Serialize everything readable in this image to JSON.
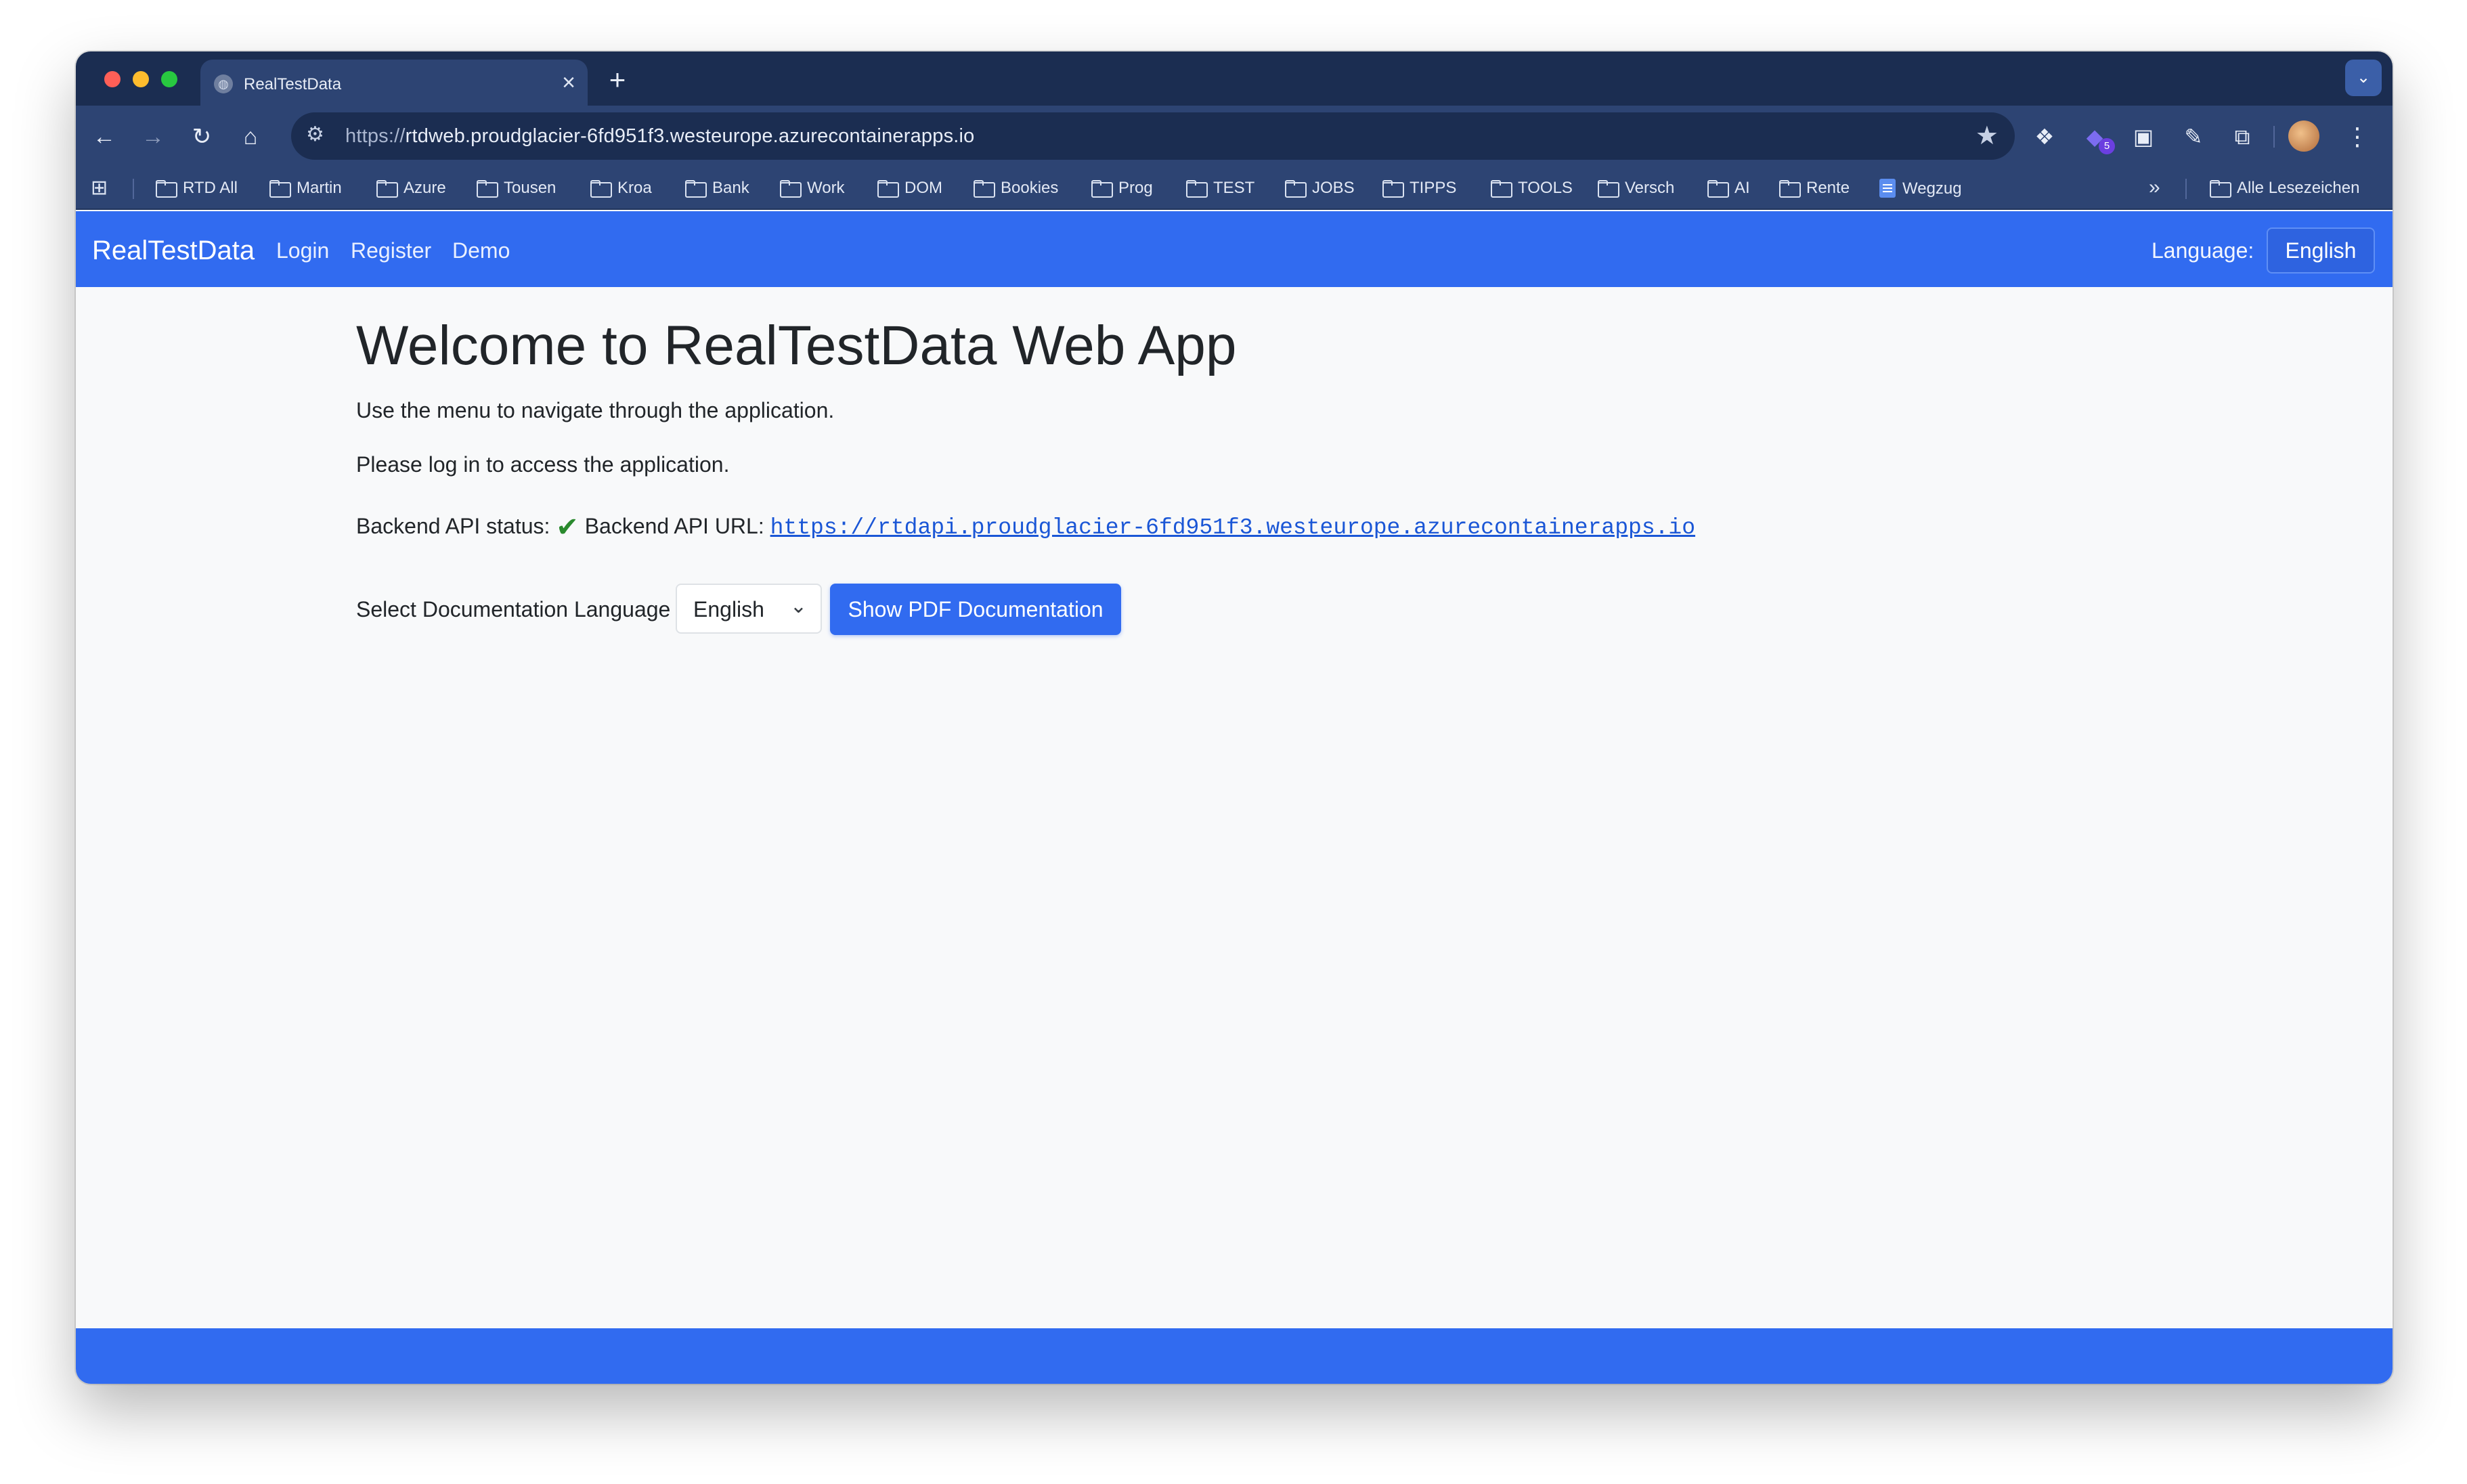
{
  "browser": {
    "tab_title": "RealTestData",
    "new_tab_symbol": "+",
    "url_scheme": "https://",
    "url_rest": "rtdweb.proudglacier-6fd951f3.westeurope.azurecontainerapps.io",
    "extension_badge": "5",
    "bookmarks": [
      {
        "label": "RTD All",
        "icon": "folder-icon"
      },
      {
        "label": "Martin",
        "icon": "folder-icon"
      },
      {
        "label": "Azure",
        "icon": "folder-icon"
      },
      {
        "label": "Tousen",
        "icon": "folder-icon"
      },
      {
        "label": "Kroa",
        "icon": "folder-icon"
      },
      {
        "label": "Bank",
        "icon": "folder-icon"
      },
      {
        "label": "Work",
        "icon": "folder-icon"
      },
      {
        "label": "DOM",
        "icon": "folder-icon"
      },
      {
        "label": "Bookies",
        "icon": "folder-icon"
      },
      {
        "label": "Prog",
        "icon": "folder-icon"
      },
      {
        "label": "TEST",
        "icon": "folder-icon"
      },
      {
        "label": "JOBS",
        "icon": "folder-icon"
      },
      {
        "label": "TIPPS",
        "icon": "folder-icon"
      },
      {
        "label": "TOOLS",
        "icon": "folder-icon"
      },
      {
        "label": "Versch",
        "icon": "folder-icon"
      },
      {
        "label": "AI",
        "icon": "folder-icon"
      },
      {
        "label": "Rente",
        "icon": "folder-icon"
      },
      {
        "label": "Wegzug",
        "icon": "document-icon"
      }
    ],
    "all_bookmarks": "Alle Lesezeichen"
  },
  "navbar": {
    "brand": "RealTestData",
    "links": [
      "Login",
      "Register",
      "Demo"
    ],
    "language_label": "Language:",
    "language_button": "English"
  },
  "main": {
    "title": "Welcome to RealTestData Web App",
    "intro": "Use the menu to navigate through the application.",
    "login_prompt": "Please log in to access the application.",
    "api_status_label": "Backend API status:",
    "api_status_icon": "✔",
    "api_url_label": "Backend API URL:",
    "api_url": "https://rtdapi.proudglacier-6fd951f3.westeurope.azurecontainerapps.io",
    "doc_language_label": "Select Documentation Language",
    "doc_language_value": "English",
    "show_pdf_button": "Show PDF Documentation"
  },
  "colors": {
    "brand_blue": "#316bf0",
    "browser_dark": "#1b2d51",
    "browser_toolbar": "#2d4473",
    "status_ok": "#2a8a2e"
  }
}
